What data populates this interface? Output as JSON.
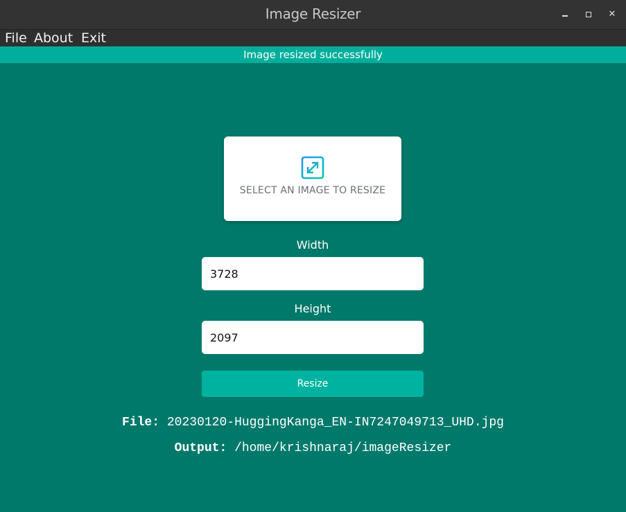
{
  "window": {
    "title": "Image Resizer"
  },
  "menu": {
    "items": [
      {
        "label": "File"
      },
      {
        "label": "About"
      },
      {
        "label": "Exit"
      }
    ]
  },
  "alert": {
    "message": "Image resized successfully",
    "color": "#00ae9b"
  },
  "dropzone": {
    "icon": "expand-arrows-icon",
    "label": "SELECT AN IMAGE TO RESIZE"
  },
  "form": {
    "width_label": "Width",
    "width_value": "3728",
    "height_label": "Height",
    "height_value": "2097",
    "resize_label": "Resize"
  },
  "info": {
    "file_label": "File:",
    "file_value": "20230120-HuggingKanga_EN-IN7247049713_UHD.jpg",
    "output_label": "Output:",
    "output_value": "/home/krishnaraj/imageResizer"
  },
  "colors": {
    "background": "#00796b",
    "accent": "#00b3a1",
    "titlebar": "#333333"
  }
}
